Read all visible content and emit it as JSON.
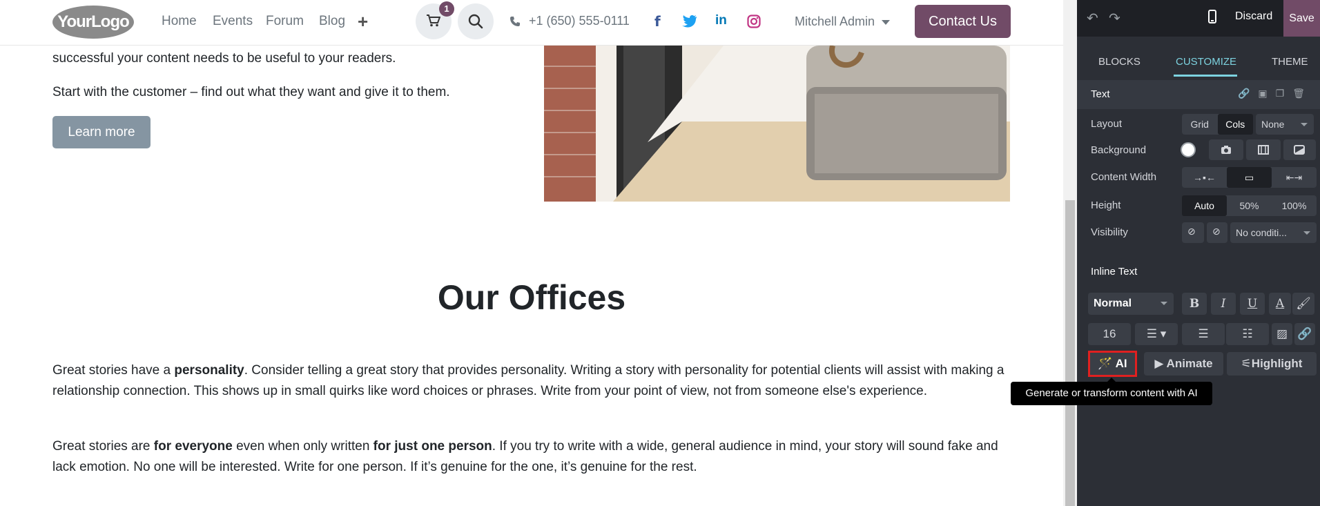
{
  "header": {
    "logo_text": "YourLogo",
    "nav": [
      "Home",
      "Events",
      "Forum",
      "Blog"
    ],
    "cart_count": "1",
    "phone": "+1 (650) 555-0111",
    "social": [
      "f",
      "t",
      "in",
      "ig"
    ],
    "user": "Mitchell Admin",
    "contact_label": "Contact Us"
  },
  "content": {
    "para1": "successful your content needs to be useful to your readers.",
    "para2": "Start with the customer – find out what they want and give it to them.",
    "learn_more": "Learn more",
    "offices_title": "Our Offices",
    "p3": {
      "a": "Great stories have a ",
      "b": "personality",
      "c": ". Consider telling a great story that provides personality. Writing a story with personality for potential clients will assist with making a relationship connection. This shows up in small quirks like word choices or phrases. Write from your point of view, not from someone else's experience."
    },
    "p4": {
      "a": "Great stories are ",
      "b": "for everyone",
      "c": " even when only written ",
      "d": "for just one person",
      "e": ". If you try to write with a wide, general audience in mind, your story will sound fake and lack emotion. No one will be interested. Write for one person. If it’s genuine for the one, it’s genuine for the rest."
    }
  },
  "editor": {
    "discard": "Discard",
    "save": "Save",
    "tabs": [
      "BLOCKS",
      "CUSTOMIZE",
      "THEME"
    ],
    "active_tab": "CUSTOMIZE",
    "text_section": "Text",
    "layout": {
      "label": "Layout",
      "options": [
        "Grid",
        "Cols"
      ],
      "selected": "Cols",
      "columns": "None"
    },
    "background_label": "Background",
    "content_width_label": "Content Width",
    "height": {
      "label": "Height",
      "options": [
        "Auto",
        "50%",
        "100%"
      ],
      "selected": "Auto"
    },
    "visibility": {
      "label": "Visibility",
      "condition": "No conditi..."
    },
    "inline_text_section": "Inline Text",
    "text_style": "Normal",
    "font_size": "16",
    "ai_label": "AI",
    "animate_label": "Animate",
    "highlight_label": "Highlight",
    "tooltip": "Generate or transform content with AI"
  },
  "colors": {
    "brand": "#714b67",
    "panel_bg": "#2c2f36",
    "accent": "#7dd3e0",
    "highlight_border": "#e02020"
  }
}
